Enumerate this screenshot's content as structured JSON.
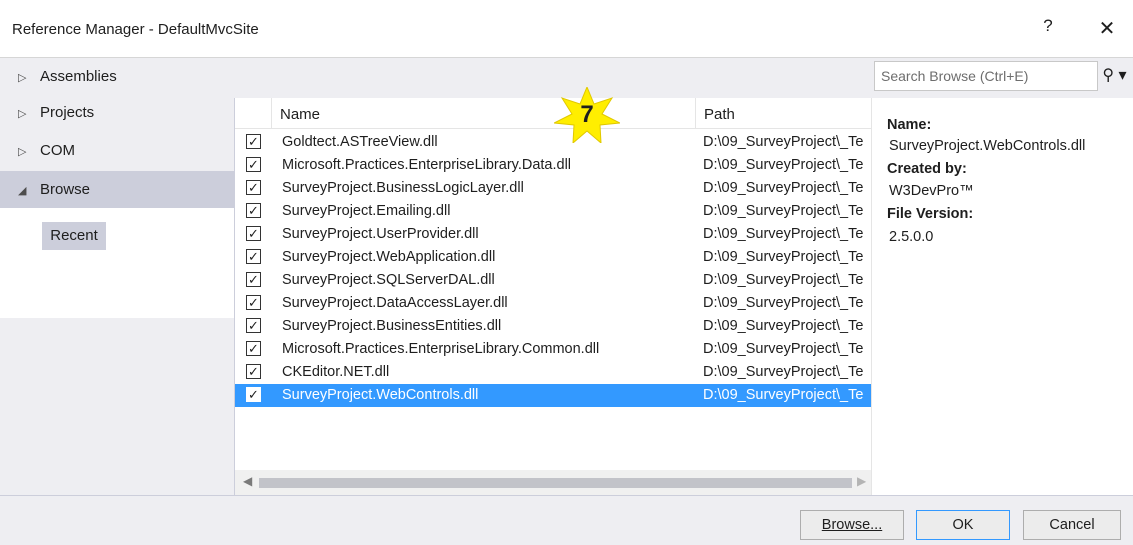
{
  "window": {
    "title": "Reference Manager - DefaultMvcSite",
    "help_label": "?",
    "close_label": "✕"
  },
  "sidebar": {
    "items": [
      {
        "label": "Assemblies",
        "expanded": false
      },
      {
        "label": "Projects",
        "expanded": false
      },
      {
        "label": "COM",
        "expanded": false
      },
      {
        "label": "Browse",
        "expanded": true
      }
    ],
    "sub_items": [
      {
        "label": "Recent"
      }
    ]
  },
  "search": {
    "placeholder": "Search Browse (Ctrl+E)"
  },
  "list": {
    "columns": {
      "name": "Name",
      "path": "Path"
    },
    "rows": [
      {
        "checked": true,
        "name": "Goldtect.ASTreeView.dll",
        "path": "D:\\09_SurveyProject\\_Te"
      },
      {
        "checked": true,
        "name": "Microsoft.Practices.EnterpriseLibrary.Data.dll",
        "path": "D:\\09_SurveyProject\\_Te"
      },
      {
        "checked": true,
        "name": "SurveyProject.BusinessLogicLayer.dll",
        "path": "D:\\09_SurveyProject\\_Te"
      },
      {
        "checked": true,
        "name": "SurveyProject.Emailing.dll",
        "path": "D:\\09_SurveyProject\\_Te"
      },
      {
        "checked": true,
        "name": "SurveyProject.UserProvider.dll",
        "path": "D:\\09_SurveyProject\\_Te"
      },
      {
        "checked": true,
        "name": "SurveyProject.WebApplication.dll",
        "path": "D:\\09_SurveyProject\\_Te"
      },
      {
        "checked": true,
        "name": "SurveyProject.SQLServerDAL.dll",
        "path": "D:\\09_SurveyProject\\_Te"
      },
      {
        "checked": true,
        "name": "SurveyProject.DataAccessLayer.dll",
        "path": "D:\\09_SurveyProject\\_Te"
      },
      {
        "checked": true,
        "name": "SurveyProject.BusinessEntities.dll",
        "path": "D:\\09_SurveyProject\\_Te"
      },
      {
        "checked": true,
        "name": "Microsoft.Practices.EnterpriseLibrary.Common.dll",
        "path": "D:\\09_SurveyProject\\_Te"
      },
      {
        "checked": true,
        "name": "CKEditor.NET.dll",
        "path": "D:\\09_SurveyProject\\_Te"
      },
      {
        "checked": true,
        "name": "SurveyProject.WebControls.dll",
        "path": "D:\\09_SurveyProject\\_Te",
        "selected": true
      }
    ]
  },
  "annotation": {
    "step_number": "7",
    "color": "#ffee00"
  },
  "details": {
    "name_label": "Name:",
    "name_value": "SurveyProject.WebControls.dll",
    "created_label": "Created by:",
    "created_value": "W3DevPro™",
    "version_label": "File Version:",
    "version_value": "2.5.0.0"
  },
  "buttons": {
    "browse": "Browse...",
    "ok": "OK",
    "cancel": "Cancel"
  },
  "colors": {
    "selection": "#3399ff",
    "nav_selected": "#cccedb",
    "chrome": "#eeeef2"
  }
}
